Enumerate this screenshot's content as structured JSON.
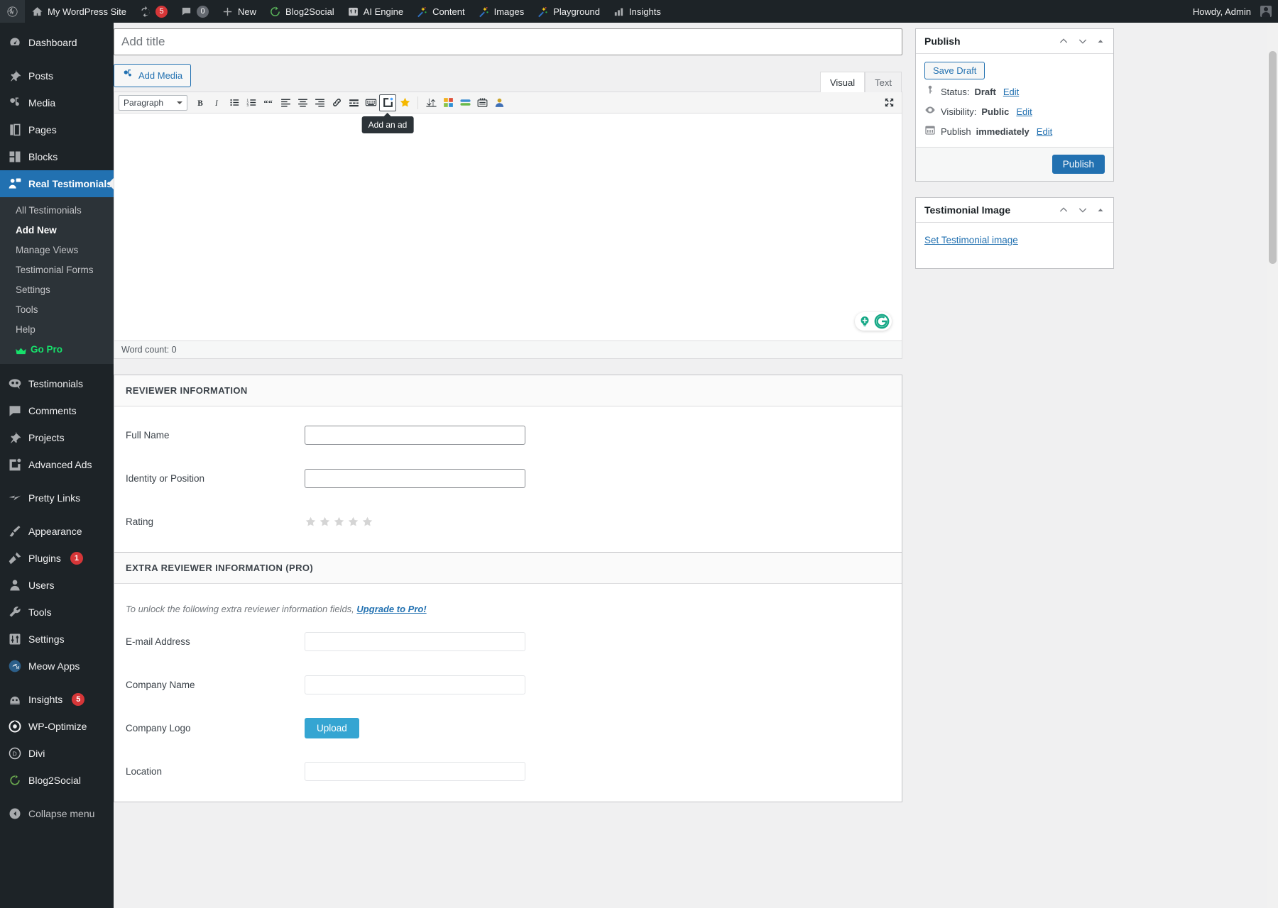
{
  "adminbar": {
    "logo_icon": "wordpress-logo-icon",
    "site_name": "My WordPress Site",
    "site_icon": "home-icon",
    "updates": {
      "icon": "update-icon",
      "count": "5"
    },
    "comments": {
      "icon": "comment-bubble-icon",
      "count": "0"
    },
    "new": {
      "icon": "plus-icon",
      "label": "New"
    },
    "items": [
      {
        "icon": "blog2social-icon",
        "label": "Blog2Social"
      },
      {
        "icon": "ai-engine-icon",
        "label": "AI Engine"
      },
      {
        "icon": "magic-wand-icon",
        "label": "Content"
      },
      {
        "icon": "magic-wand-icon",
        "label": "Images"
      },
      {
        "icon": "magic-wand-icon",
        "label": "Playground"
      },
      {
        "icon": "bar-chart-icon",
        "label": "Insights"
      }
    ],
    "howdy": "Howdy, Admin"
  },
  "sidebar": {
    "items": [
      {
        "label": "Dashboard",
        "icon": "dashboard-icon",
        "current": false
      },
      {
        "label": "Posts",
        "icon": "pin-icon",
        "current": false
      },
      {
        "label": "Media",
        "icon": "media-icon",
        "current": false
      },
      {
        "label": "Pages",
        "icon": "pages-icon",
        "current": false
      },
      {
        "label": "Blocks",
        "icon": "blocks-icon",
        "current": false
      },
      {
        "label": "Real Testimonials",
        "icon": "testimonial-user-icon",
        "current": true
      },
      {
        "label": "Testimonials",
        "icon": "testimonials-icon",
        "current": false
      },
      {
        "label": "Comments",
        "icon": "comment-bubble-icon",
        "current": false
      },
      {
        "label": "Projects",
        "icon": "pin-icon",
        "current": false
      },
      {
        "label": "Advanced Ads",
        "icon": "advanced-ads-icon",
        "current": false
      },
      {
        "label": "Pretty Links",
        "icon": "pretty-links-icon",
        "current": false
      },
      {
        "label": "Appearance",
        "icon": "paintbrush-icon",
        "current": false
      },
      {
        "label": "Plugins",
        "icon": "plug-icon",
        "current": false,
        "badge": "1"
      },
      {
        "label": "Users",
        "icon": "users-icon",
        "current": false
      },
      {
        "label": "Tools",
        "icon": "wrench-icon",
        "current": false
      },
      {
        "label": "Settings",
        "icon": "sliders-icon",
        "current": false
      },
      {
        "label": "Meow Apps",
        "icon": "meow-apps-icon",
        "current": false
      },
      {
        "label": "Insights",
        "icon": "monsterinsights-icon",
        "current": false,
        "badge": "5"
      },
      {
        "label": "WP-Optimize",
        "icon": "wp-optimize-icon",
        "current": false
      },
      {
        "label": "Divi",
        "icon": "divi-icon",
        "current": false
      },
      {
        "label": "Blog2Social",
        "icon": "blog2social-icon",
        "current": false
      }
    ],
    "submenu": [
      {
        "label": "All Testimonials",
        "current": false
      },
      {
        "label": "Add New",
        "current": true
      },
      {
        "label": "Manage Views",
        "current": false
      },
      {
        "label": "Testimonial Forms",
        "current": false
      },
      {
        "label": "Settings",
        "current": false
      },
      {
        "label": "Tools",
        "current": false
      },
      {
        "label": "Help",
        "current": false
      },
      {
        "label": "Go Pro",
        "current": false,
        "pro": true,
        "icon": "crown-icon"
      }
    ],
    "collapse": {
      "label": "Collapse menu",
      "icon": "collapse-arrow-icon"
    }
  },
  "editor": {
    "title_placeholder": "Add title",
    "title_value": "",
    "add_media_label": "Add Media",
    "add_media_icon": "add-media-icon",
    "tabs": [
      {
        "label": "Visual",
        "active": true
      },
      {
        "label": "Text",
        "active": false
      }
    ],
    "format_select": "Paragraph",
    "toolbar_buttons": [
      {
        "name": "bold-icon",
        "glyph": "B"
      },
      {
        "name": "italic-icon",
        "glyph": "I"
      },
      {
        "name": "bulleted-list-icon"
      },
      {
        "name": "numbered-list-icon"
      },
      {
        "name": "blockquote-icon"
      },
      {
        "name": "align-left-icon"
      },
      {
        "name": "align-center-icon"
      },
      {
        "name": "align-right-icon"
      },
      {
        "name": "insert-link-icon"
      },
      {
        "name": "read-more-icon"
      },
      {
        "name": "toolbar-toggle-icon"
      },
      {
        "name": "add-an-ad-icon",
        "pressed": true
      },
      {
        "name": "star-rating-icon"
      },
      {
        "name": "sort-icon"
      },
      {
        "name": "color-blocks-icon"
      },
      {
        "name": "green-bars-icon"
      },
      {
        "name": "list-lines-icon"
      },
      {
        "name": "person-icon"
      }
    ],
    "fullscreen_icon": "fullscreen-icon",
    "tooltip": "Add an ad",
    "grammarly": {
      "lightbulb_icon": "grammarly-lightbulb-icon",
      "logo_icon": "grammarly-logo-icon"
    },
    "word_count": "Word count: 0"
  },
  "reviewer_box": {
    "heading": "REVIEWER INFORMATION",
    "fields": [
      {
        "label": "Full Name",
        "type": "text",
        "value": ""
      },
      {
        "label": "Identity or Position",
        "type": "text",
        "value": ""
      },
      {
        "label": "Rating",
        "type": "stars",
        "stars": 5,
        "filled": 0
      }
    ]
  },
  "extra_box": {
    "heading": "EXTRA REVIEWER INFORMATION (PRO)",
    "note_text": "To unlock the following extra reviewer information fields,",
    "note_link": "Upgrade to Pro!",
    "fields": [
      {
        "label": "E-mail Address",
        "type": "text",
        "value": ""
      },
      {
        "label": "Company Name",
        "type": "text",
        "value": ""
      },
      {
        "label": "Company Logo",
        "type": "button",
        "button_label": "Upload"
      },
      {
        "label": "Location",
        "type": "text",
        "value": ""
      }
    ]
  },
  "publish_box": {
    "title": "Publish",
    "save_draft": "Save Draft",
    "status_label": "Status:",
    "status_value": "Draft",
    "status_edit": "Edit",
    "status_icon": "key-icon",
    "visibility_label": "Visibility:",
    "visibility_value": "Public",
    "visibility_edit": "Edit",
    "visibility_icon": "eye-icon",
    "schedule_label": "Publish",
    "schedule_value": "immediately",
    "schedule_edit": "Edit",
    "schedule_icon": "calendar-icon",
    "publish_button": "Publish",
    "controls": [
      "move-up-icon",
      "move-down-icon",
      "toggle-panel-icon"
    ]
  },
  "image_box": {
    "title": "Testimonial Image",
    "set_link": "Set Testimonial image",
    "controls": [
      "move-up-icon",
      "move-down-icon",
      "toggle-panel-icon"
    ]
  },
  "colors": {
    "admin_dark": "#1d2327",
    "admin_submenu": "#2c3338",
    "accent_blue": "#2271b1",
    "go_pro_green": "#17e06b",
    "badge_red": "#d63638",
    "upload_blue": "#35a5d2",
    "star_gold": "#f5b800"
  }
}
